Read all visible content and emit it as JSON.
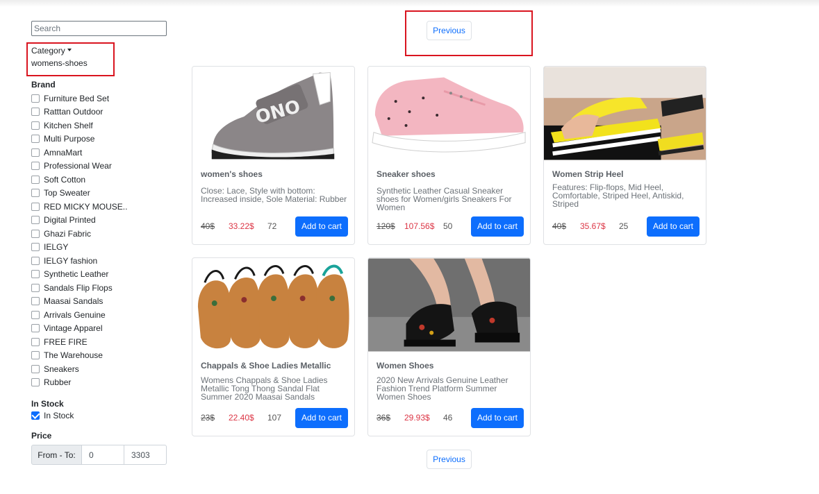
{
  "filters": {
    "search_placeholder": "Search",
    "category": {
      "label": "Category",
      "value": "womens-shoes"
    },
    "brand": {
      "title": "Brand",
      "items": [
        "Furniture Bed Set",
        "Ratttan Outdoor",
        "Kitchen Shelf",
        "Multi Purpose",
        "AmnaMart",
        "Professional Wear",
        "Soft Cotton",
        "Top Sweater",
        "RED MICKY MOUSE..",
        "Digital Printed",
        "Ghazi Fabric",
        "IELGY",
        "IELGY fashion",
        "Synthetic Leather",
        "Sandals Flip Flops",
        "Maasai Sandals",
        "Arrivals Genuine",
        "Vintage Apparel",
        "FREE FIRE",
        "The Warehouse",
        "Sneakers",
        "Rubber"
      ]
    },
    "stock": {
      "title": "In Stock",
      "option": "In Stock",
      "checked": true
    },
    "price": {
      "title": "Price",
      "prefix": "From - To:",
      "from": "0",
      "to": "3303"
    }
  },
  "pagination": {
    "top_label": "Previous",
    "bottom_label": "Previous"
  },
  "products": [
    {
      "title": "women's shoes",
      "description": "Close: Lace, Style with bottom: Increased inside, Sole Material: Rubber",
      "old_price": "40$",
      "new_price": "33.22$",
      "stock": "72",
      "cta": "Add to cart"
    },
    {
      "title": "Sneaker shoes",
      "description": "Synthetic Leather Casual Sneaker shoes for Women/girls Sneakers For Women",
      "old_price": "120$",
      "new_price": "107.56$",
      "stock": "50",
      "cta": "Add to cart"
    },
    {
      "title": "Women Strip Heel",
      "description": "Features: Flip-flops, Mid Heel, Comfortable, Striped Heel, Antiskid, Striped",
      "old_price": "40$",
      "new_price": "35.67$",
      "stock": "25",
      "cta": "Add to cart"
    },
    {
      "title": "Chappals & Shoe Ladies Metallic",
      "description": "Womens Chappals & Shoe Ladies Metallic Tong Thong Sandal Flat Summer 2020 Maasai Sandals",
      "old_price": "23$",
      "new_price": "22.40$",
      "stock": "107",
      "cta": "Add to cart"
    },
    {
      "title": "Women Shoes",
      "description": "2020 New Arrivals Genuine Leather Fashion Trend Platform Summer Women Shoes",
      "old_price": "36$",
      "new_price": "29.93$",
      "stock": "46",
      "cta": "Add to cart"
    }
  ],
  "colors": {
    "primary": "#0d6efd",
    "sale_price": "#dc3545",
    "highlight": "#d9141f"
  }
}
